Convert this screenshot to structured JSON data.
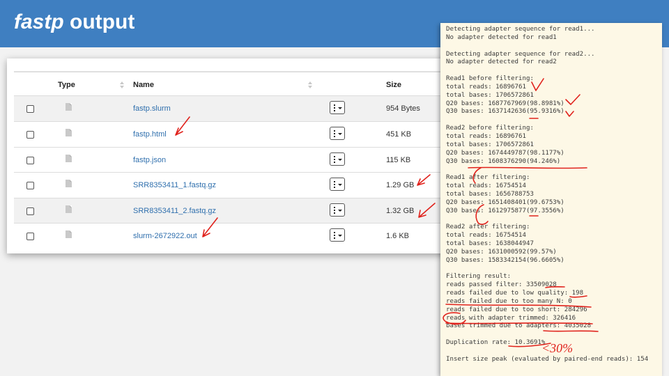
{
  "slide": {
    "title_italic": "fastp",
    "title_rest": " output"
  },
  "file_table": {
    "columns": [
      "Type",
      "Name",
      "Size"
    ],
    "rows": [
      {
        "name": "fastp.slurm",
        "size": "954 Bytes"
      },
      {
        "name": "fastp.html",
        "size": "451 KB"
      },
      {
        "name": "fastp.json",
        "size": "115 KB"
      },
      {
        "name": "SRR8353411_1.fastq.gz",
        "size": "1.29 GB"
      },
      {
        "name": "SRR8353411_2.fastq.gz",
        "size": "1.32 GB"
      },
      {
        "name": "slurm-2672922.out",
        "size": "1.6 KB"
      }
    ],
    "icons": {
      "row_checkbox": "checkbox-icon",
      "file": "file-icon",
      "actions": "kebab-menu-icon",
      "sort": "sort-icon"
    }
  },
  "terminal": {
    "lines": [
      "Detecting adapter sequence for read1...",
      "No adapter detected for read1",
      "",
      "Detecting adapter sequence for read2...",
      "No adapter detected for read2",
      "",
      "Read1 before filtering:",
      "total reads: 16896761",
      "total bases: 1706572861",
      "Q20 bases: 1687767969(98.8981%)",
      "Q30 bases: 1637142636(95.9316%)",
      "",
      "Read2 before filtering:",
      "total reads: 16896761",
      "total bases: 1706572861",
      "Q20 bases: 1674449787(98.1177%)",
      "Q30 bases: 1608376290(94.246%)",
      "",
      "Read1 after filtering:",
      "total reads: 16754514",
      "total bases: 1656788753",
      "Q20 bases: 1651408401(99.6753%)",
      "Q30 bases: 1612975877(97.3556%)",
      "",
      "Read2 after filtering:",
      "total reads: 16754514",
      "total bases: 1638044947",
      "Q20 bases: 1631000592(99.57%)",
      "Q30 bases: 1583342154(96.6605%)",
      "",
      "Filtering result:",
      "reads passed filter: 33509028",
      "reads failed due to low quality: 198",
      "reads failed due to too many N: 0",
      "reads failed due to too short: 284296",
      "reads with adapter trimmed: 326416",
      "bases trimmed due to adapters: 4035028",
      "",
      "Duplication rate: 10.3691%",
      "",
      "Insert size peak (evaluated by paired-end reads): 154"
    ]
  },
  "annotations": {
    "handwritten_note": "<30%",
    "ink_color": "#e0221c"
  }
}
